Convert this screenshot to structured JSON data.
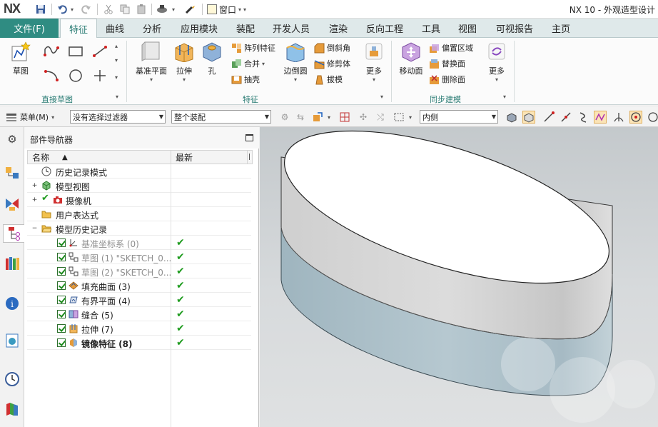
{
  "titlebar": {
    "logo": "NX",
    "window_menu": "窗口",
    "app_title": "NX 10 - 外观造型设计"
  },
  "tabs": {
    "file": "文件(F)",
    "items": [
      "特征",
      "曲线",
      "分析",
      "应用模块",
      "装配",
      "开发人员",
      "渲染",
      "反向工程",
      "工具",
      "视图",
      "可视报告",
      "主页"
    ],
    "active": "特征"
  },
  "ribbon": {
    "direct_sketch": {
      "sketch_label": "草图",
      "group_label": "直接草图"
    },
    "feature": {
      "datum_plane": "基准平面",
      "extrude": "拉伸",
      "hole": "孔",
      "pattern_feature": "阵列特征",
      "unite": "合并",
      "shell": "抽壳",
      "edge_blend": "边倒圆",
      "chamfer": "倒斜角",
      "trim_body": "修剪体",
      "draft": "拔模",
      "more": "更多",
      "group_label": "特征"
    },
    "sync": {
      "move_face": "移动面",
      "offset_region": "偏置区域",
      "replace_face": "替换面",
      "delete_face": "删除面",
      "more": "更多",
      "group_label": "同步建模"
    }
  },
  "command_bar": {
    "menu_label": "菜单(M)",
    "filter_value": "没有选择过滤器",
    "assembly_value": "整个装配",
    "scope_value": "内侧"
  },
  "navigator": {
    "title": "部件导航器",
    "col_name": "名称",
    "col_latest": "最新",
    "rows": [
      {
        "label": "历史记录模式",
        "latest": ""
      },
      {
        "label": "模型视图",
        "latest": ""
      },
      {
        "label": "摄像机",
        "latest": ""
      },
      {
        "label": "用户表达式",
        "latest": ""
      },
      {
        "label": "模型历史记录",
        "latest": ""
      },
      {
        "label": "基准坐标系 (0)",
        "latest": "✔"
      },
      {
        "label": "草图 (1) \"SKETCH_0...",
        "latest": "✔"
      },
      {
        "label": "草图 (2) \"SKETCH_0...",
        "latest": "✔"
      },
      {
        "label": "填充曲面 (3)",
        "latest": "✔"
      },
      {
        "label": "有界平面 (4)",
        "latest": "✔"
      },
      {
        "label": "缝合 (5)",
        "latest": "✔"
      },
      {
        "label": "拉伸 (7)",
        "latest": "✔"
      },
      {
        "label": "镜像特征 (8)",
        "latest": "✔"
      }
    ]
  },
  "colors": {
    "file_tab": "#2f8c82",
    "accent": "#2a7c74",
    "body_top": "#ffffff",
    "body_upper": "#d9d9d9",
    "body_lower": "#b6c7cf"
  }
}
